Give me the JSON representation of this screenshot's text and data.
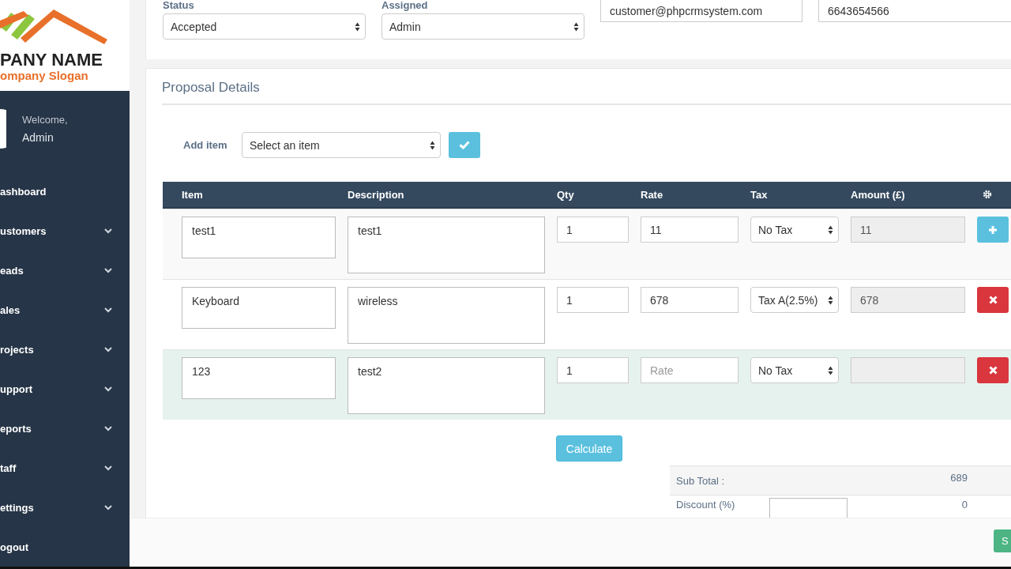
{
  "logo": {
    "name": "PANY NAME",
    "slogan": "ompany Slogan"
  },
  "user": {
    "greeting": "Welcome,",
    "name": "Admin"
  },
  "menu": [
    {
      "label": "ashboard",
      "expandable": false
    },
    {
      "label": "ustomers",
      "expandable": true
    },
    {
      "label": "eads",
      "expandable": true
    },
    {
      "label": "ales",
      "expandable": true
    },
    {
      "label": "rojects",
      "expandable": true
    },
    {
      "label": "upport",
      "expandable": true
    },
    {
      "label": "eports",
      "expandable": true
    },
    {
      "label": "taff",
      "expandable": true
    },
    {
      "label": "ettings",
      "expandable": true
    },
    {
      "label": "ogout",
      "expandable": false
    }
  ],
  "top_form": {
    "status": {
      "label": "Status",
      "value": "Accepted"
    },
    "assigned": {
      "label": "Assigned",
      "value": "Admin"
    },
    "email": "customer@phpcrmsystem.com",
    "phone": "6643654566"
  },
  "proposal": {
    "title": "Proposal Details",
    "add_item": {
      "label": "Add item",
      "value": "Select an item"
    },
    "columns": [
      "Item",
      "Description",
      "Qty",
      "Rate",
      "Tax",
      "Amount (£)"
    ],
    "rows": [
      {
        "item": "test1",
        "description": "test1",
        "qty": "1",
        "rate": "11",
        "tax": "No Tax",
        "amount": "11",
        "kind": "add",
        "highlighted": false
      },
      {
        "item": "Keyboard",
        "description": "wireless",
        "qty": "1",
        "rate": "678",
        "tax": "Tax A(2.5%)",
        "amount": "678",
        "kind": "remove",
        "highlighted": false
      },
      {
        "item": "123",
        "description": "test2",
        "qty": "1",
        "rate_placeholder": "Rate",
        "tax": "No Tax",
        "kind": "remove",
        "highlighted": true
      }
    ],
    "calculate": "Calculate",
    "subtotal": {
      "label": "Sub Total :",
      "value": "689"
    },
    "discount": {
      "label": "Discount (%)",
      "value": "0"
    }
  },
  "save": "S"
}
